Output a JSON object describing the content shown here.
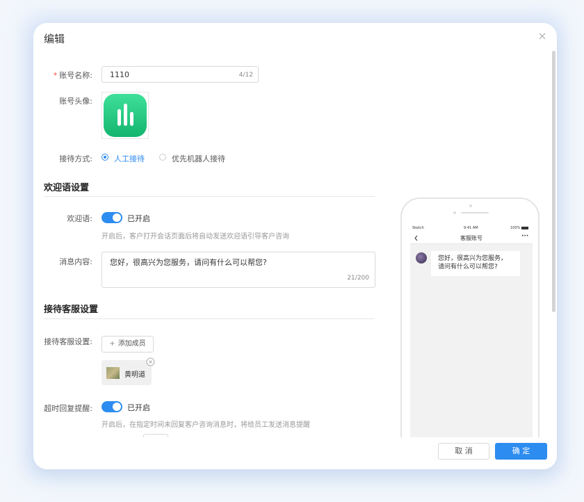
{
  "modal": {
    "title": "编辑"
  },
  "account": {
    "name_label": "账号名称:",
    "name_value": "1110",
    "name_counter": "4/12",
    "avatar_label": "账号头像:",
    "reception_label": "接待方式:",
    "reception_options": [
      {
        "label": "人工接待",
        "selected": true
      },
      {
        "label": "优先机器人接待",
        "selected": false
      }
    ]
  },
  "welcome": {
    "section_title": "欢迎语设置",
    "toggle_label": "欢迎语:",
    "toggle_state": "已开启",
    "hint": "开启后，客户打开会话页面后将自动发送欢迎语引导客户咨询",
    "message_label": "消息内容:",
    "message_value": "您好，很高兴为您服务，请问有什么可以帮您?",
    "message_counter": "21/200"
  },
  "service": {
    "section_title": "接待客服设置",
    "member_label": "接待客服设置:",
    "add_member_button": "添加成员",
    "members": [
      {
        "name": "黄明道"
      }
    ],
    "timeout_label": "超时回复提醒:",
    "timeout_state": "已开启",
    "timeout_hint": "开启后，在指定时间未回复客户咨询消息时，将给员工发送消息提醒"
  },
  "footer": {
    "cancel_label": "取 消",
    "confirm_label": "确 定"
  },
  "preview": {
    "carrier": "Sketch",
    "time": "9:41 AM",
    "battery": "100%",
    "nav_title": "客服账号",
    "message_line1": "您好，很高兴为您服务，",
    "message_line2": "请问有什么可以帮您?"
  },
  "colors": {
    "accent": "#2d8cf0",
    "avatar_gradient_top": "#3fe09a",
    "avatar_gradient_bottom": "#13b56e"
  }
}
